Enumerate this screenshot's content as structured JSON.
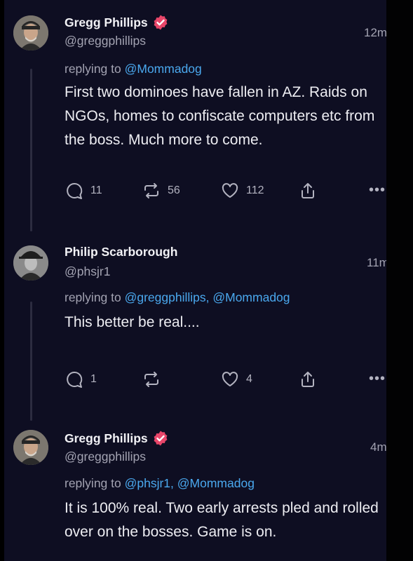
{
  "posts": [
    {
      "name": "Gregg Phillips",
      "verified": true,
      "handle": "@greggphillips",
      "time": "12m",
      "replying_prefix": "replying to ",
      "replying_to": "@Mommadog",
      "text": "First two dominoes have fallen in AZ. Raids on NGOs, homes to confiscate computers etc from the boss. Much more to come.",
      "replies": "11",
      "reposts": "56",
      "likes": "112",
      "more": "•••"
    },
    {
      "name": "Philip Scarborough",
      "verified": false,
      "handle": "@phsjr1",
      "time": "11m",
      "replying_prefix": "replying to ",
      "replying_to": "@greggphillips, @Mommadog",
      "text": "This better be real....",
      "replies": "1",
      "reposts": "",
      "likes": "4",
      "more": "•••"
    },
    {
      "name": "Gregg Phillips",
      "verified": true,
      "handle": "@greggphillips",
      "time": "4m",
      "replying_prefix": "replying to ",
      "replying_to": "@phsjr1, @Mommadog",
      "text": "It is 100% real. Two early arrests pled and rolled over on the bosses. Game is on."
    }
  ],
  "icons": {
    "reply": "reply-icon",
    "repost": "repost-icon",
    "like": "heart-icon",
    "share": "share-icon",
    "verified": "verified-badge-icon",
    "more": "more-options-icon"
  },
  "colors": {
    "background": "#0e0e22",
    "mention": "#4aa8ee",
    "verified": "#e8466a",
    "secondary_text": "#a3a3b2"
  }
}
